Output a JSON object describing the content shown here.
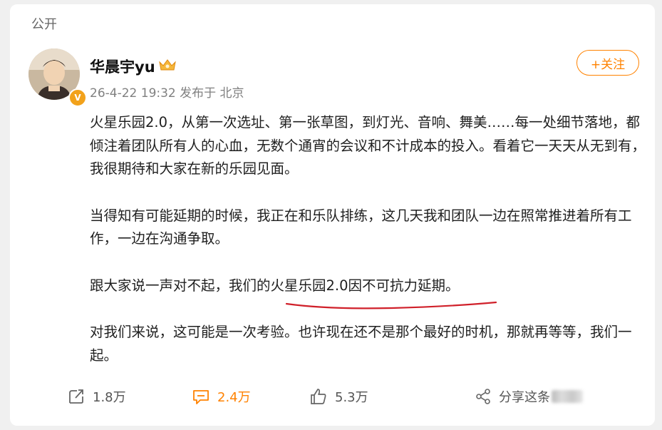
{
  "post": {
    "visibility": "公开",
    "author": "华晨宇yu",
    "timestamp": "26-4-22 19:32",
    "location": "发布于 北京",
    "follow_label": "+关注",
    "paragraphs": [
      "火星乐园2.0，从第一次选址、第一张草图，到灯光、音响、舞美……每一处细节落地，都倾注着团队所有人的心血，无数个通宵的会议和不计成本的投入。看着它一天天从无到有，我很期待和大家在新的乐园见面。",
      "当得知有可能延期的时候，我正在和乐队排练，这几天我和团队一边在照常推进着所有工作，一边在沟通争取。",
      "跟大家说一声对不起，我们的火星乐园2.0因不可抗力延期。",
      "对我们来说，这可能是一次考验。也许现在还不是那个最好的时机，那就再等等，我们一起。"
    ]
  },
  "actions": {
    "repost_count": "1.8万",
    "comment_count": "2.4万",
    "like_count": "5.3万",
    "share_label": "分享这条"
  },
  "colors": {
    "accent": "#ff8200",
    "underline": "#d0202a",
    "text": "#1f1f1f",
    "meta": "#808080"
  },
  "icons": [
    "crown-icon",
    "verified-badge-icon",
    "repost-icon",
    "comment-icon",
    "like-icon",
    "share-icon"
  ]
}
